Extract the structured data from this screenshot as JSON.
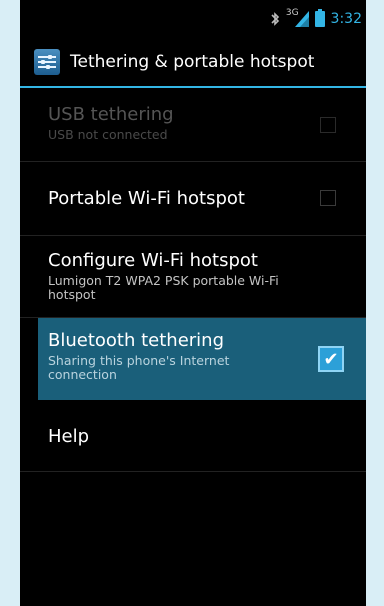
{
  "status_bar": {
    "bluetooth_icon": "bluetooth-icon",
    "network_type": "3G",
    "signal_icon": "signal-icon",
    "battery_icon": "battery-icon",
    "time": "3:32",
    "accent_color": "#33b5e5"
  },
  "action_bar": {
    "icon": "settings-sliders-icon",
    "title": "Tethering & portable hotspot"
  },
  "items": [
    {
      "title": "USB tethering",
      "summary": "USB not connected",
      "checked": false,
      "enabled": false
    },
    {
      "title": "Portable Wi-Fi hotspot",
      "summary": "",
      "checked": false,
      "enabled": true
    },
    {
      "title": "Configure Wi-Fi hotspot",
      "summary": "Lumigon T2 WPA2 PSK portable Wi-Fi hotspot",
      "enabled": true
    },
    {
      "title": "Bluetooth tethering",
      "summary": "Sharing this phone's Internet connection",
      "checked": true,
      "enabled": true,
      "selected": true
    },
    {
      "title": "Help",
      "summary": "",
      "enabled": true
    }
  ],
  "colors": {
    "selected_row": "#1a5f7a",
    "checkbox_checked": "#2ca0d8"
  }
}
